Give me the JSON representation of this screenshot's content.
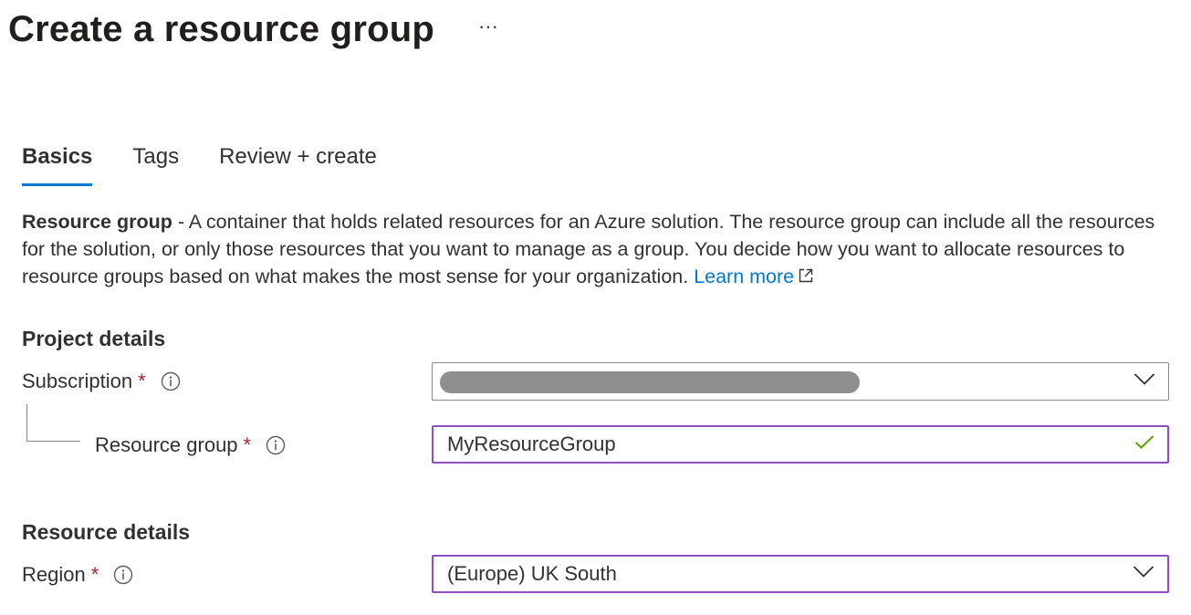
{
  "header": {
    "title": "Create a resource group",
    "more_label": "···"
  },
  "tabs": [
    {
      "label": "Basics",
      "active": true
    },
    {
      "label": "Tags",
      "active": false
    },
    {
      "label": "Review + create",
      "active": false
    }
  ],
  "description": {
    "term": "Resource group",
    "text": " - A container that holds related resources for an Azure solution. The resource group can include all the resources for the solution, or only those resources that you want to manage as a group. You decide how you want to allocate resources to resource groups based on what makes the most sense for your organization. ",
    "link_label": "Learn more",
    "link_icon": "external-link-icon"
  },
  "project_details": {
    "heading": "Project details",
    "subscription": {
      "label": "Subscription",
      "required_mark": "*",
      "value": "",
      "value_redacted": true,
      "trail_icon": "chevron-down-icon"
    },
    "resource_group": {
      "label": "Resource group",
      "required_mark": "*",
      "value": "MyResourceGroup",
      "valid": true,
      "trail_icon": "checkmark-icon"
    }
  },
  "resource_details": {
    "heading": "Resource details",
    "region": {
      "label": "Region",
      "required_mark": "*",
      "value": "(Europe) UK South",
      "trail_icon": "chevron-down-icon"
    }
  },
  "colors": {
    "accent_blue": "#0078d4",
    "focus_purple": "#8f4fc3",
    "required_red": "#a4262c",
    "valid_green": "#57a300",
    "text": "#323130",
    "border": "#8a8886"
  }
}
